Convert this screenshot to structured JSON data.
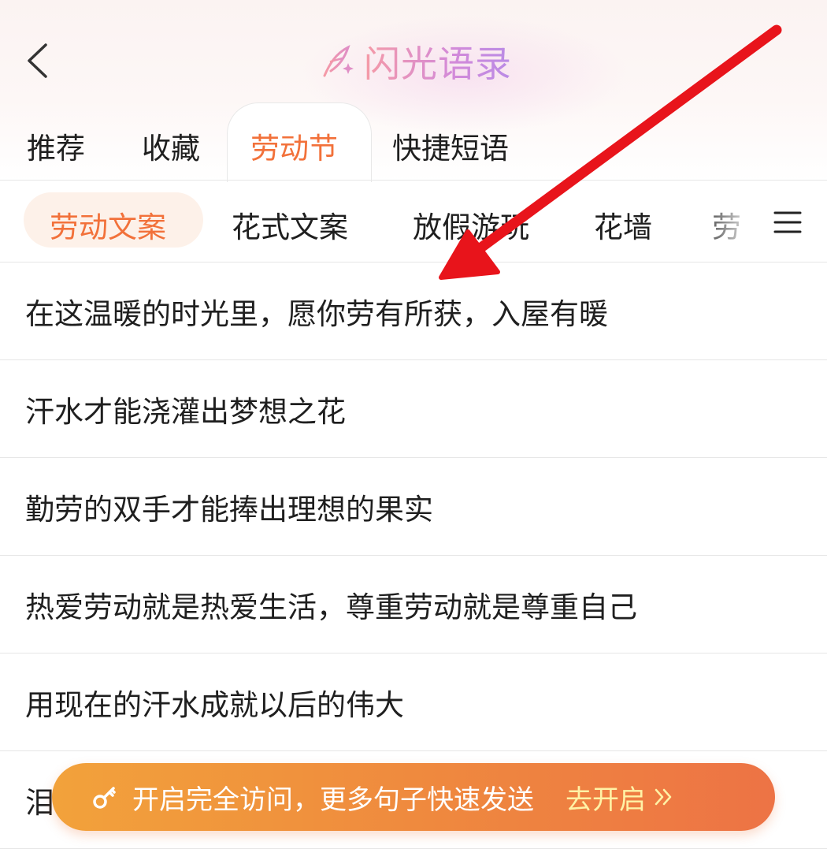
{
  "header": {
    "title": "闪光语录",
    "back_icon": "chevron-left-icon",
    "title_icon": "quill-sparkle-icon"
  },
  "tabs": [
    {
      "label": "推荐",
      "active": false
    },
    {
      "label": "收藏",
      "active": false
    },
    {
      "label": "劳动节",
      "active": true
    },
    {
      "label": "快捷短语",
      "active": false
    }
  ],
  "subtabs": [
    {
      "label": "劳动文案",
      "active": true
    },
    {
      "label": "花式文案",
      "active": false
    },
    {
      "label": "放假游玩",
      "active": false
    },
    {
      "label": "花墙",
      "active": false
    },
    {
      "label": "劳",
      "active": false
    }
  ],
  "menu_icon": "hamburger-menu-icon",
  "phrases": [
    "在这温暖的时光里，愿你劳有所获，入屋有暖",
    "汗水才能浇灌出梦想之花",
    "勤劳的双手才能捧出理想的果实",
    "热爱劳动就是热爱生活，尊重劳动就是尊重自己",
    "用现在的汗水成就以后的伟大",
    "泪"
  ],
  "banner": {
    "icon": "key-icon",
    "text": "开启完全访问，更多句子快速发送",
    "cta": "去开启",
    "cta_icon": "double-chevron-right-icon"
  },
  "colors": {
    "accent": "#f2713a",
    "pill_bg": "#fdf1e9",
    "banner_start": "#f2a23b",
    "banner_end": "#ed7345",
    "cta_text": "#fff2a6",
    "annotation_arrow": "#e8141b"
  },
  "annotation": {
    "type": "arrow",
    "color": "#e8141b"
  }
}
